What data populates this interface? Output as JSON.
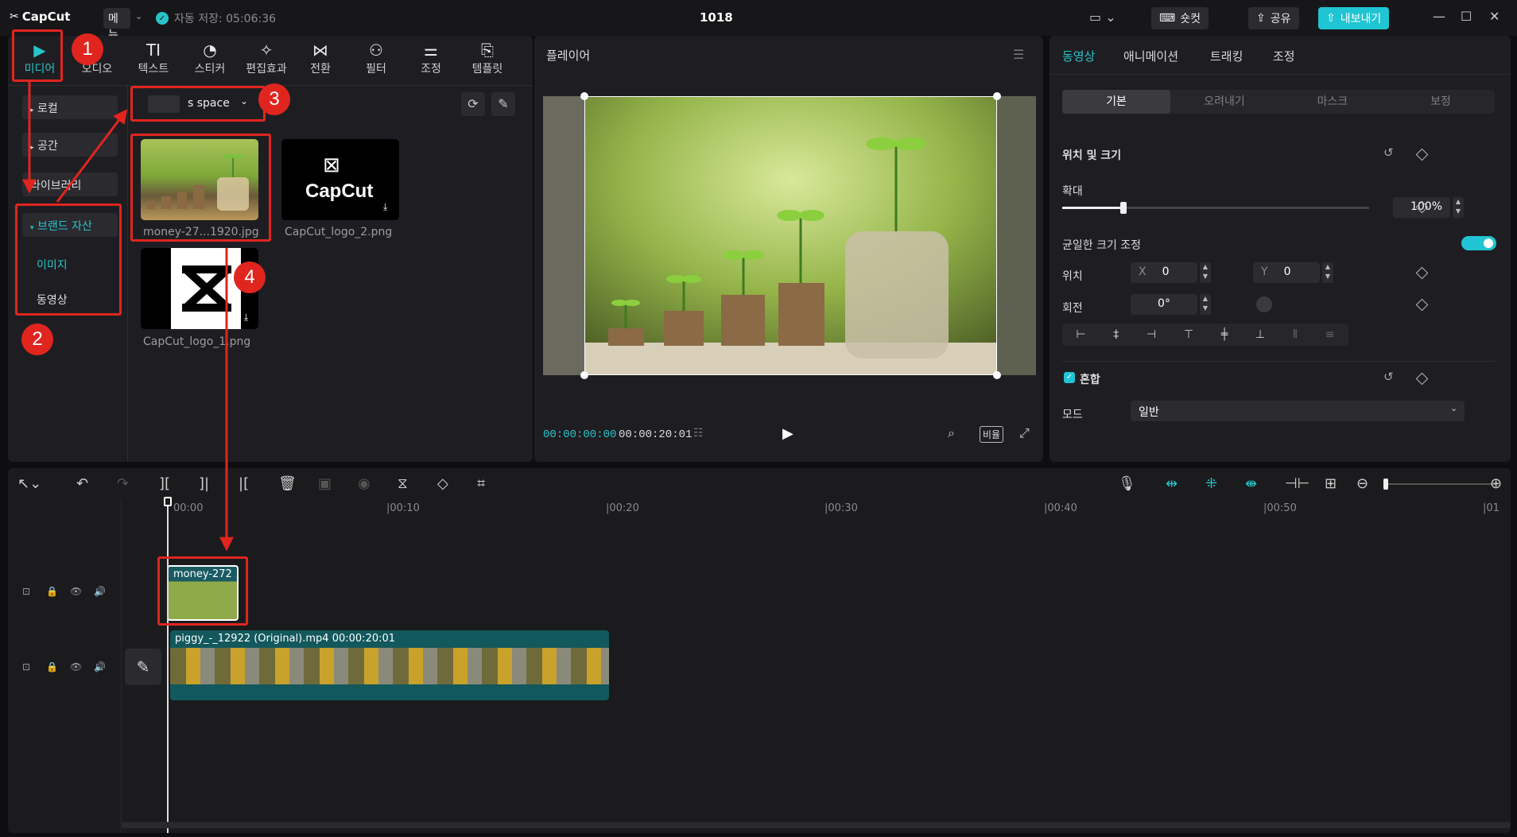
{
  "titlebar": {
    "logo": "CapCut",
    "menu": "메뉴",
    "autosave": "자동 저장: 05:06:36",
    "project": "1018",
    "shortcut": "숏컷",
    "share": "공유",
    "export": "내보내기"
  },
  "tools": [
    {
      "label": "미디어",
      "icon": "play-icon"
    },
    {
      "label": "오디오",
      "icon": "music-icon"
    },
    {
      "label": "텍스트",
      "icon": "text-icon"
    },
    {
      "label": "스티커",
      "icon": "sticker-icon"
    },
    {
      "label": "편집효과",
      "icon": "effects-icon"
    },
    {
      "label": "전환",
      "icon": "transition-icon"
    },
    {
      "label": "필터",
      "icon": "filter-icon"
    },
    {
      "label": "조정",
      "icon": "adjust-icon"
    },
    {
      "label": "템플릿",
      "icon": "template-icon"
    }
  ],
  "sidebar": {
    "local": "로컬",
    "space": "공간",
    "library": "라이브러리",
    "brand": "브랜드 자산",
    "image": "이미지",
    "video": "동영상"
  },
  "space_select": "s space",
  "media": [
    {
      "name": "money-27...1920.jpg"
    },
    {
      "name": "CapCut_logo_2.png",
      "logo_text": "CapCut"
    },
    {
      "name": "CapCut_logo_1.png"
    }
  ],
  "badges": [
    "1",
    "2",
    "3",
    "4"
  ],
  "player": {
    "title": "플레이어",
    "current": "00:00:00:00",
    "total": "00:00:20:01",
    "ratio": "비율"
  },
  "right": {
    "tabs": [
      "동영상",
      "애니메이션",
      "트래킹",
      "조정"
    ],
    "subtabs": [
      "기본",
      "오려내기",
      "마스크",
      "보정"
    ],
    "pos_size": "위치 및 크기",
    "scale": "확대",
    "scale_value": "100%",
    "scale_level": 0.2,
    "uniform": "균일한 크기 조정",
    "position": "위치",
    "x_label": "X",
    "x_value": "0",
    "y_label": "Y",
    "y_value": "0",
    "rotation": "회전",
    "rotation_value": "0°",
    "blend": "혼합",
    "mode": "모드",
    "mode_value": "일반"
  },
  "timeline": {
    "ticks": [
      "00:00",
      "|00:10",
      "|00:20",
      "|00:30",
      "|00:40",
      "|00:50",
      "|01"
    ],
    "clip1": "money-272",
    "clip2": "piggy_-_12922 (Original).mp4",
    "clip2_dur": "00:00:20:01"
  },
  "colors": {
    "accent": "#26c4c8",
    "annotation": "#e0251f",
    "clip": "#1a6e6e"
  }
}
